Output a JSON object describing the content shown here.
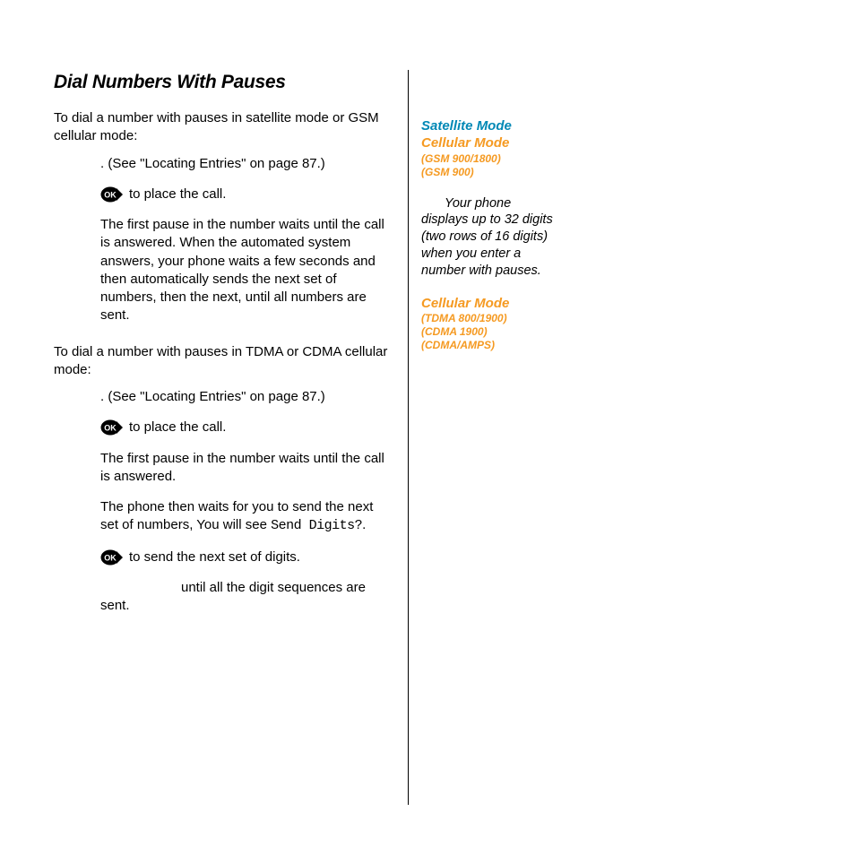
{
  "title": "Dial Numbers With Pauses",
  "intro1": "To dial a number with pauses in satellite mode or GSM cellular mode:",
  "block1": {
    "step1_tail": ". (See \"Locating Entries\" on page 87.)",
    "step2_tail": "to place the call.",
    "explain": "The first pause in the number waits until the call is answered. When the automated system answers, your phone waits a few seconds and then automatically sends the next set of numbers, then the next, until all numbers are sent."
  },
  "intro2": "To dial a number with pauses in TDMA or CDMA cellular mode:",
  "block2": {
    "step1_tail": ". (See \"Locating Entries\" on page 87.)",
    "step2_tail": "to place the call.",
    "explain1": "The first pause in the number waits until the call is answered.",
    "explain2_pre": "The phone then waits for you to send the next set of numbers, You will see ",
    "explain2_lcd": "Send Digits?",
    "explain2_post": ".",
    "step3_tail": "to send the next set of digits.",
    "step4_tail": "until all the digit sequences are sent."
  },
  "sidebar": {
    "sat_mode": "Satellite Mode",
    "cell_mode1": "Cellular Mode",
    "gsm1": "(GSM 900/1800)",
    "gsm2": "(GSM 900)",
    "note": "Your phone displays up to 32 digits (two rows of 16 digits) when you enter a number with pauses.",
    "cell_mode2": "Cellular Mode",
    "tdma": "(TDMA 800/1900)",
    "cdma1": "(CDMA 1900)",
    "cdma2": "(CDMA/AMPS)"
  }
}
